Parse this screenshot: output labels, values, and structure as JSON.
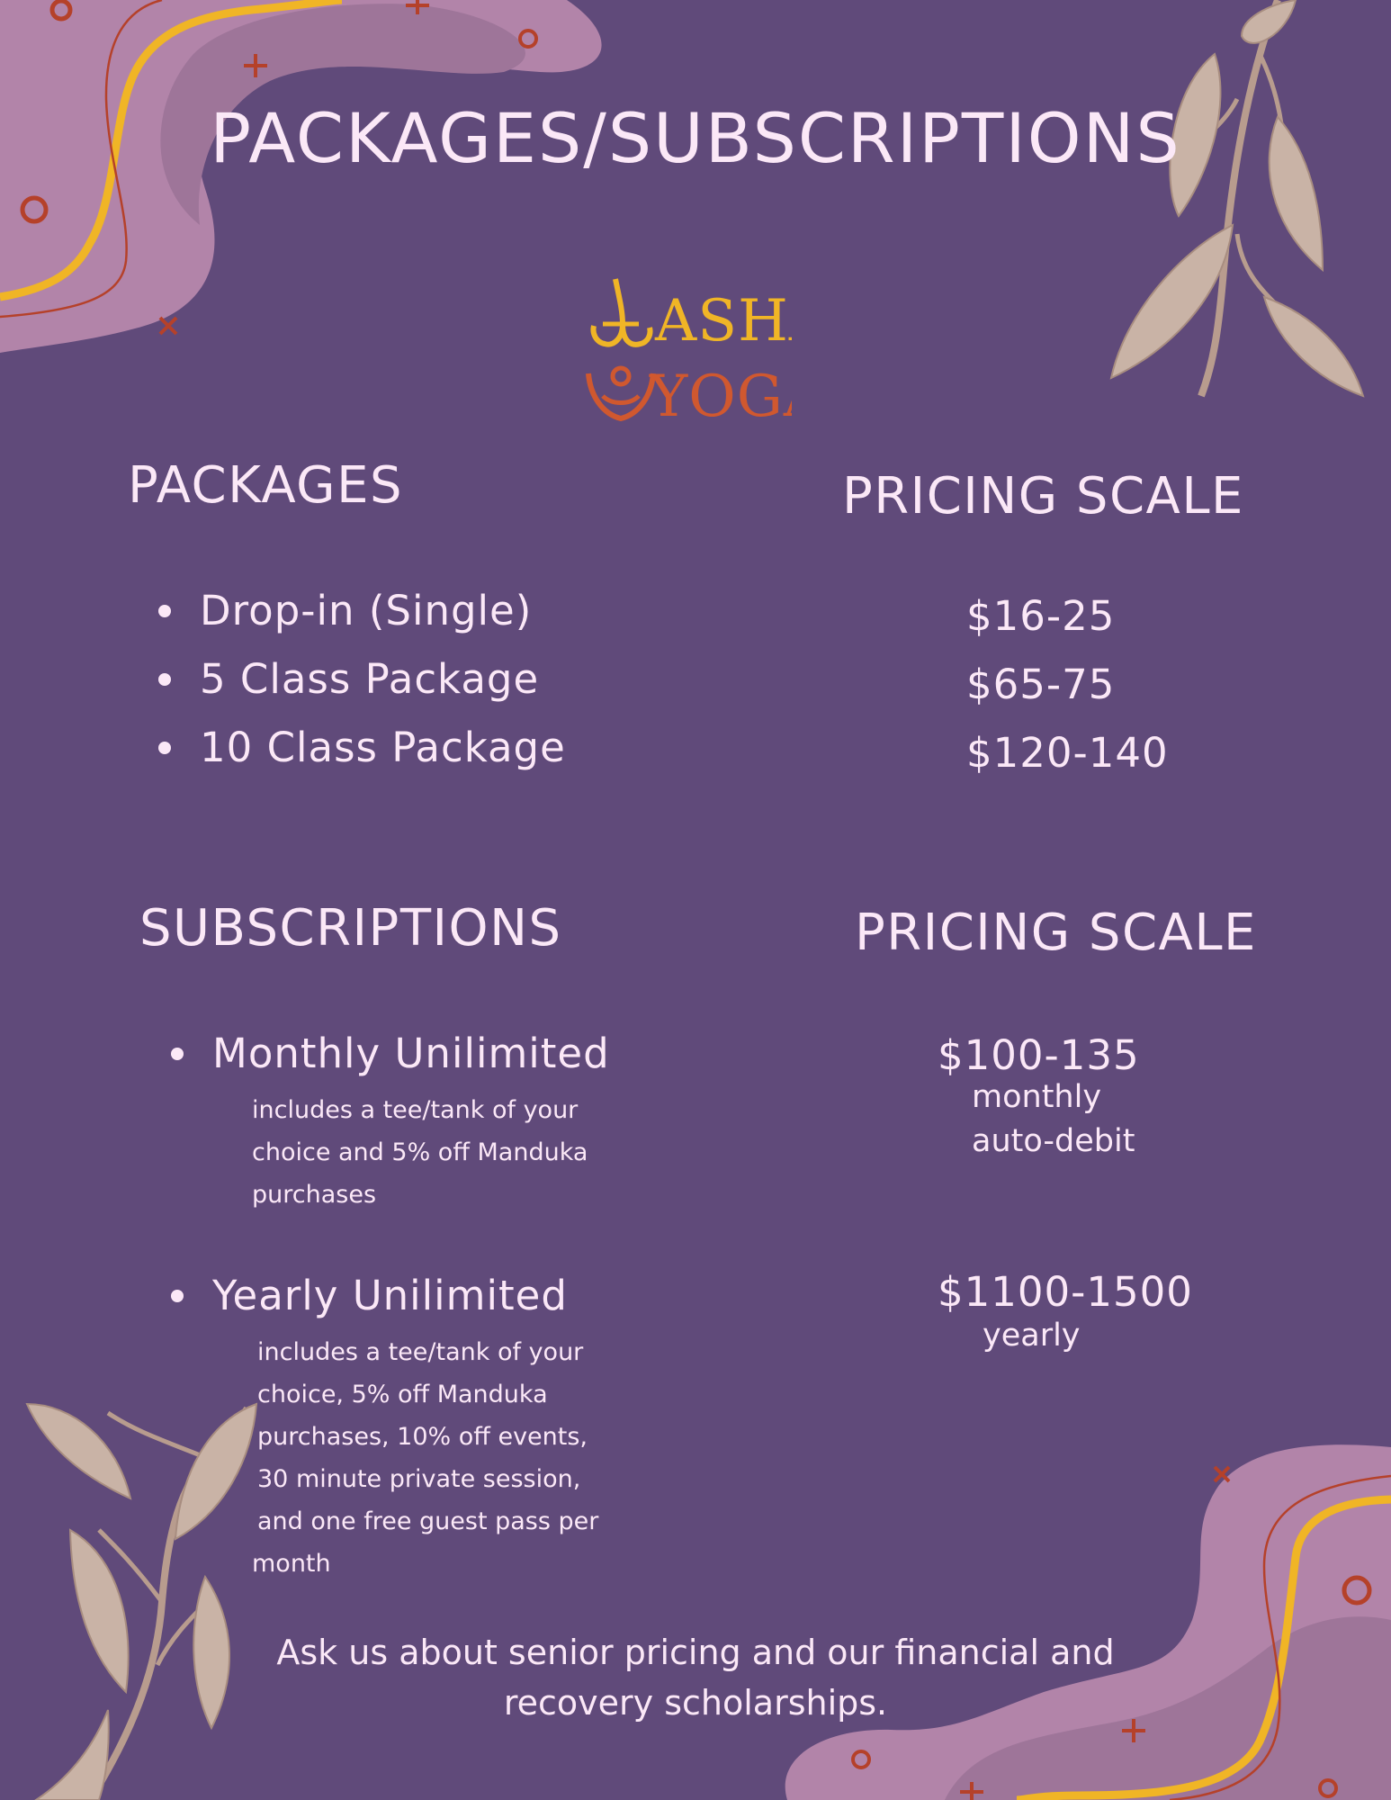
{
  "page": {
    "title": "PACKAGES/SUBSCRIPTIONS",
    "logo": {
      "line1": "ASHA",
      "line2": "YOGA"
    },
    "colors": {
      "background": "#604a7a",
      "text": "#fbe8f7",
      "blob_light": "#b284a9",
      "blob_mid": "#9e7599",
      "accent_yellow": "#f0b526",
      "accent_rust": "#b5412a",
      "leaf": "#c9b3a6"
    }
  },
  "packages": {
    "heading": "PACKAGES",
    "items": [
      "Drop-in (Single)",
      "5 Class Package",
      "10 Class Package"
    ]
  },
  "packages_pricing": {
    "heading": "PRICING SCALE",
    "prices": [
      "$16-25",
      "$65-75",
      "$120-140"
    ]
  },
  "subscriptions": {
    "heading": "SUBSCRIPTIONS",
    "items": [
      {
        "name": "Monthly Unilimited",
        "note_lines": [
          "includes a tee/tank of your",
          "choice and 5% off Manduka",
          "purchases"
        ]
      },
      {
        "name": "Yearly Unilimited",
        "note_lines": [
          "includes a tee/tank of your",
          "choice, 5% off Manduka",
          "purchases, 10% off events,",
          "30 minute private session,",
          "and one free guest pass per",
          "month"
        ]
      }
    ]
  },
  "subscriptions_pricing": {
    "heading": "PRICING SCALE",
    "monthly": {
      "price": "$100-135",
      "lines": [
        "monthly",
        "auto-debit"
      ]
    },
    "yearly": {
      "price": "$1100-1500",
      "lines": [
        "yearly"
      ]
    }
  },
  "footer": {
    "lines": [
      "Ask us about senior pricing and our financial and",
      "recovery scholarships."
    ]
  }
}
